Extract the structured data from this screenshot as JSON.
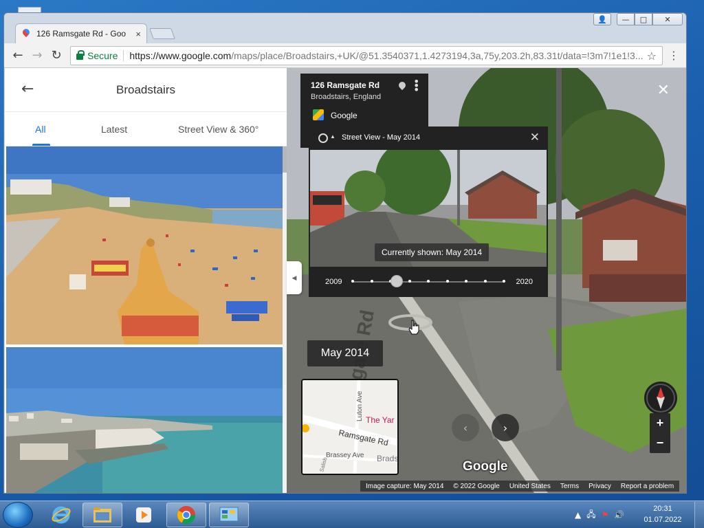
{
  "browser": {
    "tab_title": "126 Ramsgate Rd - Goo",
    "tab_close": "×",
    "window_controls": {
      "user": "👤",
      "minimize": "—",
      "maximize": "□",
      "close": "✕"
    },
    "secure_label": "Secure",
    "url_host": "https://www.google.com",
    "url_path": "/maps/place/Broadstairs,+UK/@51.3540371,1.4273194,3a,75y,203.2h,83.31t/data=!3m7!1e1!3...",
    "nav": {
      "back": "←",
      "forward": "→",
      "reload": "↻",
      "star": "☆",
      "menu": "⋮"
    }
  },
  "sidebar": {
    "back_arrow": "←",
    "title": "Broadstairs",
    "tabs": [
      {
        "label": "All"
      },
      {
        "label": "Latest"
      },
      {
        "label": "Street View & 360°"
      }
    ],
    "collapse_arrow": "◀"
  },
  "streetview": {
    "address_title": "126 Ramsgate Rd",
    "address_subtitle": "Broadstairs, England",
    "provider": "Google",
    "close": "✕",
    "timemachine": {
      "title": "Street View - May 2014",
      "close": "✕",
      "currently_shown": "Currently shown: May 2014",
      "year_start": "2009",
      "year_end": "2020",
      "selected_fraction": 0.29
    },
    "date_label": "May 2014",
    "minimap": {
      "street": "Ramsgate Rd",
      "poi": "The Yar",
      "street2": "Brassey Ave",
      "street3": "Luton Ave",
      "town": "Brads",
      "side": "Salisb"
    },
    "nav_left": "‹",
    "nav_right": "›",
    "zoom_in": "+",
    "zoom_out": "−",
    "brand": "Google",
    "road_text": "Ramsgate Rd",
    "footer": [
      "Image capture: May 2014",
      "© 2022 Google",
      "United States",
      "Terms",
      "Privacy",
      "Report a problem"
    ]
  },
  "taskbar": {
    "clock_time": "20:31",
    "clock_date": "01.07.2022"
  },
  "colors": {
    "accent": "#1a73e8",
    "secure": "#0b8043",
    "dark_panel": "#222222"
  }
}
